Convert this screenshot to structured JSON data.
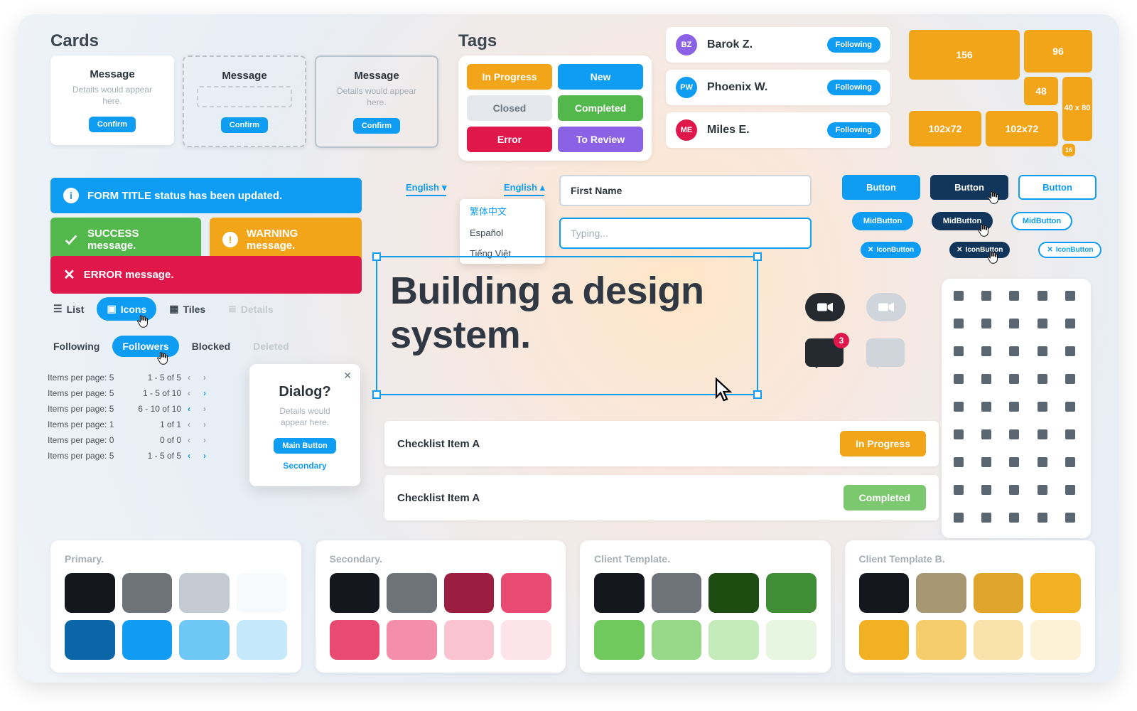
{
  "sections": {
    "cards": "Cards",
    "tags": "Tags"
  },
  "cards": [
    {
      "title": "Message",
      "details": "Details would appear here.",
      "button": "Confirm"
    },
    {
      "title": "Message",
      "details": "",
      "button": "Confirm"
    },
    {
      "title": "Message",
      "details": "Details would appear here.",
      "button": "Confirm"
    }
  ],
  "tags_grid": [
    {
      "label": "In Progress",
      "color": "#f2a518"
    },
    {
      "label": "New",
      "color": "#0f9cf3"
    },
    {
      "label": "Closed",
      "color": "grey"
    },
    {
      "label": "Completed",
      "color": "#52b84c"
    },
    {
      "label": "Error",
      "color": "#e0174b"
    },
    {
      "label": "To Review",
      "color": "#8b62e6"
    }
  ],
  "users": [
    {
      "initials": "BZ",
      "name": "Barok Z.",
      "color": "#8b62e6",
      "btn": "Following"
    },
    {
      "initials": "PW",
      "name": "Phoenix W.",
      "color": "#0f9cf3",
      "btn": "Following"
    },
    {
      "initials": "ME",
      "name": "Miles E.",
      "color": "#e0174b",
      "btn": "Following"
    }
  ],
  "thumbs": {
    "a": "156",
    "b": "96",
    "c": "48",
    "d": "40 x 80",
    "e": "102x72",
    "f": "102x72",
    "g": "16"
  },
  "alerts": {
    "info": "FORM TITLE status has been updated.",
    "success": "SUCCESS message.",
    "warning": "WARNING message.",
    "error": "ERROR message."
  },
  "language": {
    "closed_label": "English",
    "open_label": "English",
    "options": [
      "繁体中文",
      "Español",
      "Tiếng Việt"
    ]
  },
  "inputs": {
    "first_name": "First Name",
    "typing": "Typing..."
  },
  "buttons": {
    "big": "Button",
    "mid": "MidButton",
    "icon": "IconButton"
  },
  "view_seg": [
    "List",
    "Icons",
    "Tiles",
    "Details"
  ],
  "follow_tabs": [
    "Following",
    "Followers",
    "Blocked",
    "Deleted"
  ],
  "pagers": [
    {
      "label": "Items per page: 5",
      "range": "1 - 5 of 5",
      "prev": false,
      "next": false
    },
    {
      "label": "Items per page: 5",
      "range": "1 - 5 of 10",
      "prev": false,
      "next": true
    },
    {
      "label": "Items per page: 5",
      "range": "6 - 10 of 10",
      "prev": true,
      "next": false
    },
    {
      "label": "Items per page: 1",
      "range": "1 of 1",
      "prev": false,
      "next": false
    },
    {
      "label": "Items per page: 0",
      "range": "0 of 0",
      "prev": false,
      "next": false
    },
    {
      "label": "Items per page: 5",
      "range": "1 - 5 of 5",
      "prev": true,
      "next": true
    }
  ],
  "dialog": {
    "title": "Dialog?",
    "details": "Details would appear here.",
    "main": "Main Button",
    "secondary": "Secondary"
  },
  "headline": "Building a design system.",
  "chat_badge": "3",
  "checklist": [
    {
      "name": "Checklist Item A",
      "status": "In Progress",
      "color": "#f2a518"
    },
    {
      "name": "Checklist Item A",
      "status": "Completed",
      "color": "#7cc86f"
    }
  ],
  "palettes": [
    {
      "title": "Primary.",
      "colors": [
        "#14181e",
        "#6e7379",
        "#c4cad1",
        "#f7fafc",
        "#0b66a8",
        "#109cf3",
        "#6fc7f6",
        "#c6e8fb"
      ]
    },
    {
      "title": "Secondary.",
      "colors": [
        "#14181e",
        "#6e7379",
        "#9b1d3f",
        "#e84a72",
        "#e84a72",
        "#f48fab",
        "#f9c3d2",
        "#fde3ea"
      ]
    },
    {
      "title": "Client Template.",
      "colors": [
        "#14181e",
        "#6e7379",
        "#1e4d12",
        "#3f8e35",
        "#6fc95c",
        "#97d989",
        "#c6ebbb",
        "#e6f6e0"
      ]
    },
    {
      "title": "Client Template B.",
      "colors": [
        "#14181e",
        "#a79773",
        "#e0a52d",
        "#f2b023",
        "#f2b023",
        "#f5cd6b",
        "#f9e3aa",
        "#fdf2d6"
      ]
    }
  ]
}
